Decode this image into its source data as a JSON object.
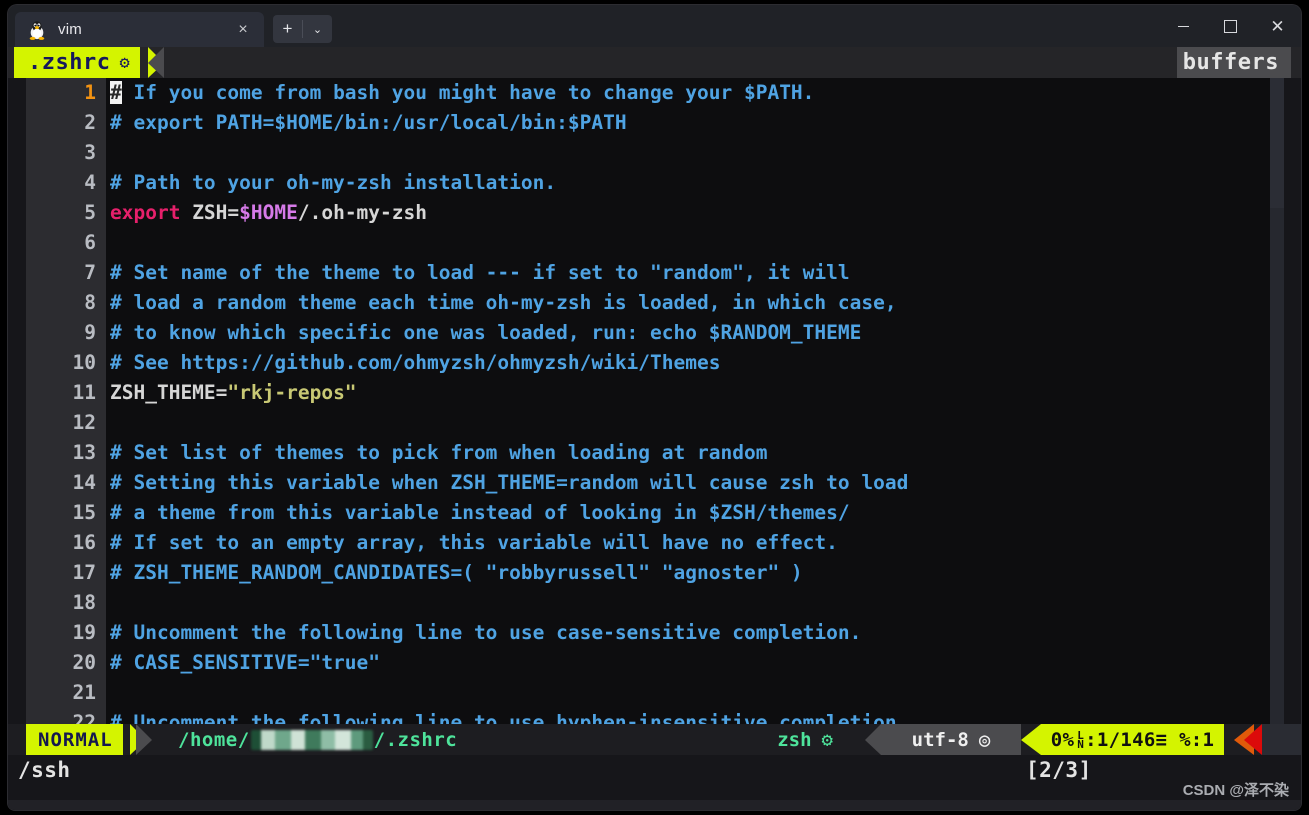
{
  "window": {
    "tabs": [
      {
        "icon": "linux-penguin-icon",
        "label": "vim",
        "close_label": "×"
      }
    ],
    "new_tab_label": "+",
    "tab_dropdown_label": "⌄",
    "controls": {
      "minimize": "–",
      "maximize": "□",
      "close": "✕"
    }
  },
  "bufferline": {
    "active_buffer": ".zshrc",
    "active_buffer_icon": "⚙",
    "right_label": "buffers"
  },
  "editor": {
    "cursor_line": 1,
    "lines": [
      {
        "no": "1",
        "segments": [
          {
            "t": "#",
            "c": "cursor"
          },
          {
            "t": " If you come from bash you might have to change your $PATH.",
            "c": "cmt"
          }
        ]
      },
      {
        "no": "2",
        "segments": [
          {
            "t": "# export PATH=$HOME/bin:/usr/local/bin:$PATH",
            "c": "cmt"
          }
        ]
      },
      {
        "no": "3",
        "segments": []
      },
      {
        "no": "4",
        "segments": [
          {
            "t": "# Path to your oh-my-zsh installation.",
            "c": "cmt"
          }
        ]
      },
      {
        "no": "5",
        "segments": [
          {
            "t": "export",
            "c": "kw"
          },
          {
            "t": " ZSH=",
            "c": "id"
          },
          {
            "t": "$HOME",
            "c": "var"
          },
          {
            "t": "/.oh-my-zsh",
            "c": "id"
          }
        ]
      },
      {
        "no": "6",
        "segments": []
      },
      {
        "no": "7",
        "segments": [
          {
            "t": "# Set name of the theme to load --- if set to \"random\", it will",
            "c": "cmt"
          }
        ]
      },
      {
        "no": "8",
        "segments": [
          {
            "t": "# load a random theme each time oh-my-zsh is loaded, in which case,",
            "c": "cmt"
          }
        ]
      },
      {
        "no": "9",
        "segments": [
          {
            "t": "# to know which specific one was loaded, run: echo $RANDOM_THEME",
            "c": "cmt"
          }
        ]
      },
      {
        "no": "10",
        "segments": [
          {
            "t": "# See https://github.com/ohmyzsh/ohmyzsh/wiki/Themes",
            "c": "cmt"
          }
        ]
      },
      {
        "no": "11",
        "segments": [
          {
            "t": "ZSH_THEME=",
            "c": "id"
          },
          {
            "t": "\"rkj-repos\"",
            "c": "str"
          }
        ]
      },
      {
        "no": "12",
        "segments": []
      },
      {
        "no": "13",
        "segments": [
          {
            "t": "# Set list of themes to pick from when loading at random",
            "c": "cmt"
          }
        ]
      },
      {
        "no": "14",
        "segments": [
          {
            "t": "# Setting this variable when ZSH_THEME=random will cause zsh to load",
            "c": "cmt"
          }
        ]
      },
      {
        "no": "15",
        "segments": [
          {
            "t": "# a theme from this variable instead of looking in $ZSH/themes/",
            "c": "cmt"
          }
        ]
      },
      {
        "no": "16",
        "segments": [
          {
            "t": "# If set to an empty array, this variable will have no effect.",
            "c": "cmt"
          }
        ]
      },
      {
        "no": "17",
        "segments": [
          {
            "t": "# ZSH_THEME_RANDOM_CANDIDATES=( \"robbyrussell\" \"agnoster\" )",
            "c": "cmt"
          }
        ]
      },
      {
        "no": "18",
        "segments": []
      },
      {
        "no": "19",
        "segments": [
          {
            "t": "# Uncomment the following line to use case-sensitive completion.",
            "c": "cmt"
          }
        ]
      },
      {
        "no": "20",
        "segments": [
          {
            "t": "# CASE_SENSITIVE=\"true\"",
            "c": "cmt"
          }
        ]
      },
      {
        "no": "21",
        "segments": []
      },
      {
        "no": "22",
        "segments": [
          {
            "t": "# Uncomment the following line to use hyphen-insensitive completion.",
            "c": "cmt"
          }
        ]
      }
    ]
  },
  "statusline": {
    "mode": "NORMAL",
    "path_prefix": "/home/",
    "path_suffix": "/.zshrc",
    "path_redacted": true,
    "filetype": "zsh",
    "filetype_icon": "⚙",
    "encoding": "utf-8",
    "encoding_icon": "◎",
    "percent": "0%",
    "line_info": ":1/146",
    "line_icon": "LN",
    "list_icon": "≡",
    "col_info": "%:1"
  },
  "cmdline": {
    "command": "/ssh",
    "match_count": "[2/3]"
  },
  "watermark": "CSDN @泽不染",
  "colors": {
    "accent_yellow": "#d4f400",
    "comment_blue": "#4fa3e3",
    "keyword_pink": "#e6206b",
    "variable_purple": "#d67ae8",
    "string_khaki": "#c8c874",
    "path_green": "#4ee39b",
    "current_line_orange": "#f29212",
    "cap_orange": "#e05a0a",
    "cap_red": "#dc0a0a"
  }
}
